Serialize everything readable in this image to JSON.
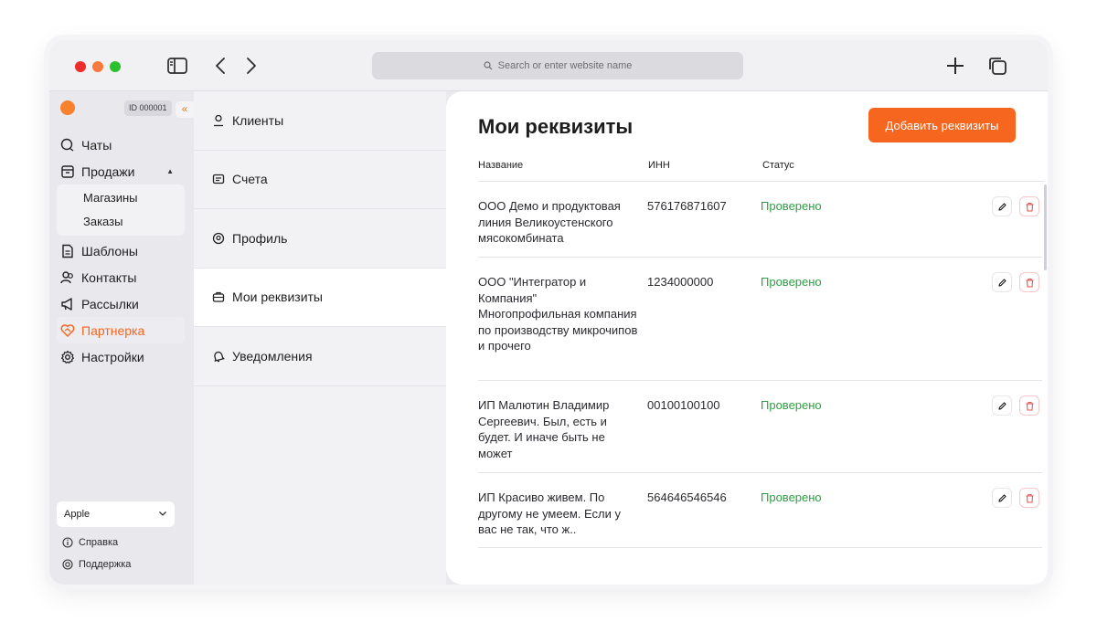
{
  "browser": {
    "url_placeholder": "Search or enter website name"
  },
  "sidebar": {
    "account_id": "ID 000001",
    "collapse_label": "«",
    "items": [
      {
        "label": "Чаты",
        "icon": "chat-icon"
      },
      {
        "label": "Продажи",
        "icon": "store-icon",
        "expanded": true,
        "children": [
          {
            "label": "Магазины"
          },
          {
            "label": "Заказы"
          }
        ]
      },
      {
        "label": "Шаблоны",
        "icon": "document-icon"
      },
      {
        "label": "Контакты",
        "icon": "contacts-icon"
      },
      {
        "label": "Рассылки",
        "icon": "megaphone-icon"
      },
      {
        "label": "Партнерка",
        "icon": "heart-handshake-icon",
        "active": true
      },
      {
        "label": "Настройки",
        "icon": "gear-icon"
      }
    ],
    "workspace_select": "Apple",
    "footer": {
      "help": "Справка",
      "support": "Поддержка"
    }
  },
  "settings_menu": {
    "items": [
      {
        "label": "Клиенты",
        "icon": "user-icon"
      },
      {
        "label": "Счета",
        "icon": "invoice-icon"
      },
      {
        "label": "Профиль",
        "icon": "profile-icon"
      },
      {
        "label": "Мои реквизиты",
        "icon": "briefcase-icon",
        "active": true
      },
      {
        "label": "Уведомления",
        "icon": "bell-icon"
      }
    ]
  },
  "main": {
    "title": "Мои реквизиты",
    "add_button": "Добавить реквизиты",
    "columns": {
      "name": "Название",
      "inn": "ИНН",
      "status": "Статус"
    },
    "rows": [
      {
        "name": "ООО Демо и продуктовая линия Великоустенского мясокомбината",
        "inn": "576176871607",
        "status": "Проверено"
      },
      {
        "name": "ООО \"Интегратор и Компания\" Многопрофильная компания по производству микрочипов и прочего",
        "inn": "1234000000",
        "status": "Проверено"
      },
      {
        "name": "ИП Малютин Владимир Сергеевич. Был, есть и будет. И иначе быть не может",
        "inn": "00100100100",
        "status": "Проверено"
      },
      {
        "name": "ИП Красиво живем. По другому не умеем. Если у вас не так, что ж..",
        "inn": "564646546546",
        "status": "Проверено"
      }
    ]
  },
  "colors": {
    "accent": "#f7661f",
    "status_ok": "#2f9e44",
    "delete": "#e55353"
  }
}
